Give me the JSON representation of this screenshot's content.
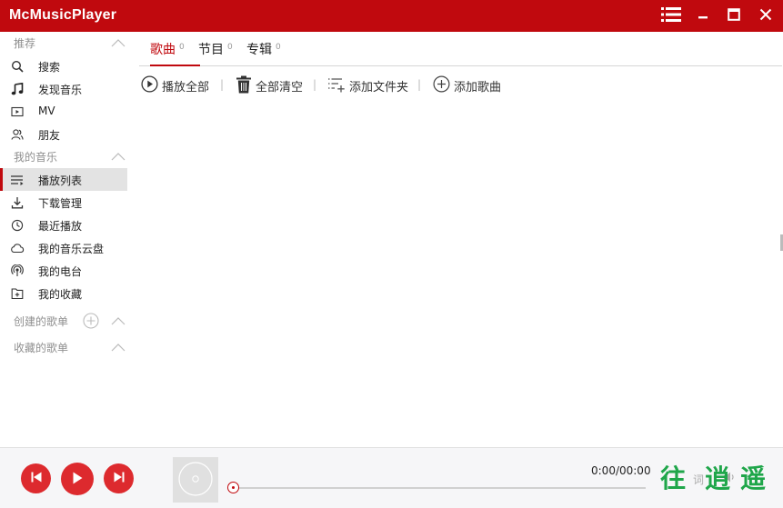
{
  "app": {
    "title": "McMusicPlayer"
  },
  "window_controls": [
    "menu-icon",
    "minimize-icon",
    "maximize-icon",
    "close-icon"
  ],
  "sidebar": {
    "sections": [
      {
        "label": "推荐",
        "items": [
          {
            "label": "搜索",
            "icon": "search-icon"
          },
          {
            "label": "发现音乐",
            "icon": "music-note-icon"
          },
          {
            "label": "MV",
            "icon": "video-icon"
          },
          {
            "label": "朋友",
            "icon": "friends-icon"
          }
        ]
      },
      {
        "label": "我的音乐",
        "items": [
          {
            "label": "播放列表",
            "icon": "playlist-icon",
            "active": true
          },
          {
            "label": "下载管理",
            "icon": "download-icon"
          },
          {
            "label": "最近播放",
            "icon": "clock-icon"
          },
          {
            "label": "我的音乐云盘",
            "icon": "cloud-icon"
          },
          {
            "label": "我的电台",
            "icon": "radio-icon"
          },
          {
            "label": "我的收藏",
            "icon": "collection-icon"
          }
        ]
      },
      {
        "label": "创建的歌单",
        "items": []
      },
      {
        "label": "收藏的歌单",
        "items": []
      }
    ]
  },
  "tabs": [
    {
      "label": "歌曲",
      "count": "0",
      "active": true
    },
    {
      "label": "节目",
      "count": "0"
    },
    {
      "label": "专辑",
      "count": "0"
    }
  ],
  "toolbar": {
    "play_all": "播放全部",
    "clear_all": "全部清空",
    "add_folder": "添加文件夹",
    "add_song": "添加歌曲",
    "separator": "|"
  },
  "player": {
    "time": "0:00/00:00",
    "lyrics_label": "词",
    "progress": 0
  },
  "watermark": {
    "chars": [
      "往",
      "逍",
      "遥"
    ]
  },
  "colors": {
    "accent": "#c0090e",
    "button_red": "#dd2a2e",
    "watermark_green": "#1fa64a"
  }
}
